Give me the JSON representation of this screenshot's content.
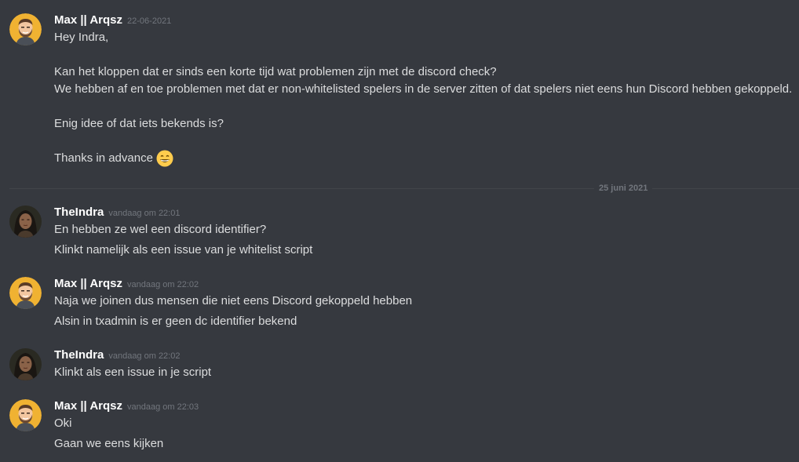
{
  "date_divider": "25 juni 2021",
  "messages": [
    {
      "author": "Max || Arqsz",
      "timestamp": "22-06-2021",
      "avatar": "bearded-man-avatar",
      "lines": [
        "Hey Indra,",
        "Kan het kloppen dat er sinds een korte tijd wat problemen zijn met de discord check?",
        "We hebben af en toe problemen met dat er non-whitelisted spelers in de server zitten of dat spelers niet eens hun Discord hebben gekoppeld.",
        "Enig idee of dat iets bekends is?",
        "Thanks in advance"
      ],
      "emoji": "grinning-face-emoji"
    },
    {
      "author": "TheIndra",
      "timestamp": "vandaag om 22:01",
      "avatar": "photo-woman-avatar",
      "lines": [
        "En hebben ze wel een discord identifier?",
        "Klinkt namelijk als een issue van je whitelist script"
      ]
    },
    {
      "author": "Max || Arqsz",
      "timestamp": "vandaag om 22:02",
      "avatar": "bearded-man-avatar",
      "lines": [
        "Naja we joinen dus mensen die niet eens Discord gekoppeld hebben",
        "Alsin in txadmin is er geen dc identifier bekend"
      ]
    },
    {
      "author": "TheIndra",
      "timestamp": "vandaag om 22:02",
      "avatar": "photo-woman-avatar",
      "lines": [
        "Klinkt als een issue in je script"
      ]
    },
    {
      "author": "Max || Arqsz",
      "timestamp": "vandaag om 22:03",
      "avatar": "bearded-man-avatar",
      "lines": [
        "Oki",
        "Gaan we eens kijken"
      ]
    }
  ],
  "colors": {
    "background": "#36393f",
    "username": "#ffffff",
    "text": "#dcddde",
    "timestamp": "#72767d",
    "avatar_bg": "#f0b232"
  }
}
